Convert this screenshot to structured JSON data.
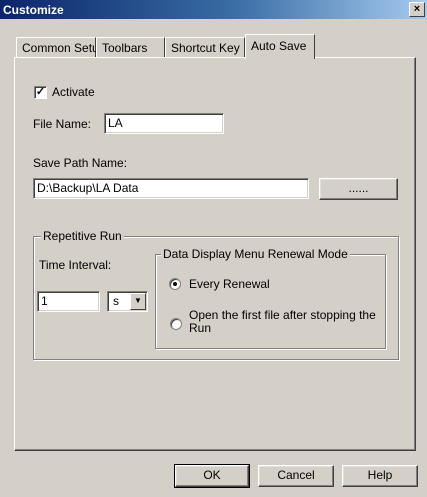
{
  "window": {
    "title": "Customize",
    "close_glyph": "×"
  },
  "tabs": [
    {
      "label": "Common Setup",
      "active": false
    },
    {
      "label": "Toolbars",
      "active": false
    },
    {
      "label": "Shortcut Key",
      "active": false
    },
    {
      "label": "Auto Save",
      "active": true
    }
  ],
  "auto_save": {
    "activate_label": "Activate",
    "activate_checked": true,
    "file_name_label": "File Name:",
    "file_name_value": "LA",
    "save_path_label": "Save Path Name:",
    "save_path_value": "D:\\Backup\\LA Data",
    "browse_label": "......",
    "repetitive_run": {
      "legend": "Repetitive Run",
      "time_interval_label": "Time Interval:",
      "time_interval_value": "1",
      "unit_value": "s",
      "renewal_mode": {
        "legend": "Data Display Menu Renewal Mode",
        "options": [
          {
            "label": "Every Renewal",
            "selected": true
          },
          {
            "label": "Open the first file after stopping the Run",
            "selected": false
          }
        ]
      }
    }
  },
  "footer": {
    "ok_label": "OK",
    "cancel_label": "Cancel",
    "help_label": "Help"
  },
  "icons": {
    "checkbox_check": "check-icon",
    "combo_arrow": "chevron-down-icon"
  }
}
